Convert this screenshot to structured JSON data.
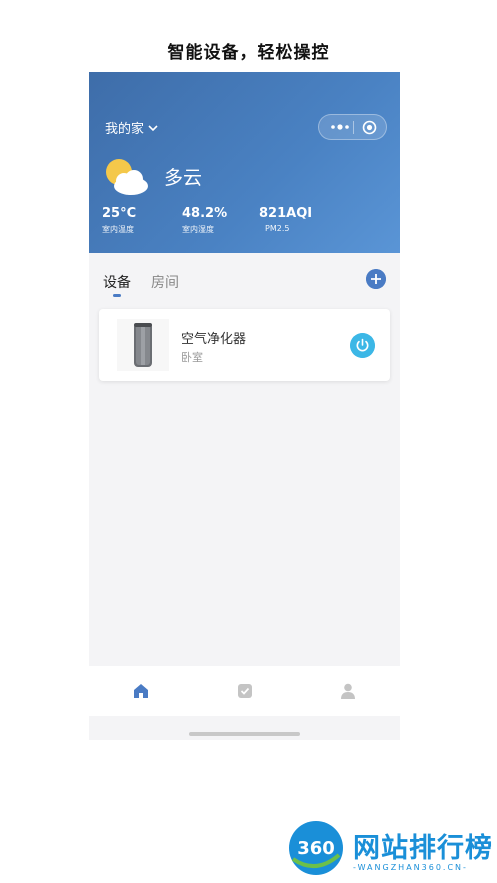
{
  "headline": "智能设备，轻松操控",
  "header": {
    "home_label": "我的家",
    "weather": {
      "condition": "多云",
      "icon": "partly-cloudy-icon"
    },
    "stats": [
      {
        "value": "25°C",
        "label": "室内温度"
      },
      {
        "value": "48.2%",
        "label": "室内湿度"
      },
      {
        "value": "821AQI",
        "label": "PM2.5"
      }
    ]
  },
  "tabs": [
    {
      "label": "设备",
      "active": true
    },
    {
      "label": "房间",
      "active": false
    }
  ],
  "devices": [
    {
      "name": "空气净化器",
      "room": "卧室",
      "icon": "air-purifier-icon",
      "power": "power-icon"
    }
  ],
  "bottom_nav": [
    {
      "icon": "home-icon",
      "active": true
    },
    {
      "icon": "checkbox-icon",
      "active": false
    },
    {
      "icon": "user-icon",
      "active": false
    }
  ],
  "watermark": {
    "logo_text": "360",
    "title": "网站排行榜",
    "url": "-WANGZHAN360.CN-"
  },
  "colors": {
    "header_gradient_start": "#3e6da9",
    "header_gradient_end": "#5a95d6",
    "accent": "#4a7bc4",
    "power_button": "#3cb7e6",
    "watermark": "#1a8fd8"
  }
}
